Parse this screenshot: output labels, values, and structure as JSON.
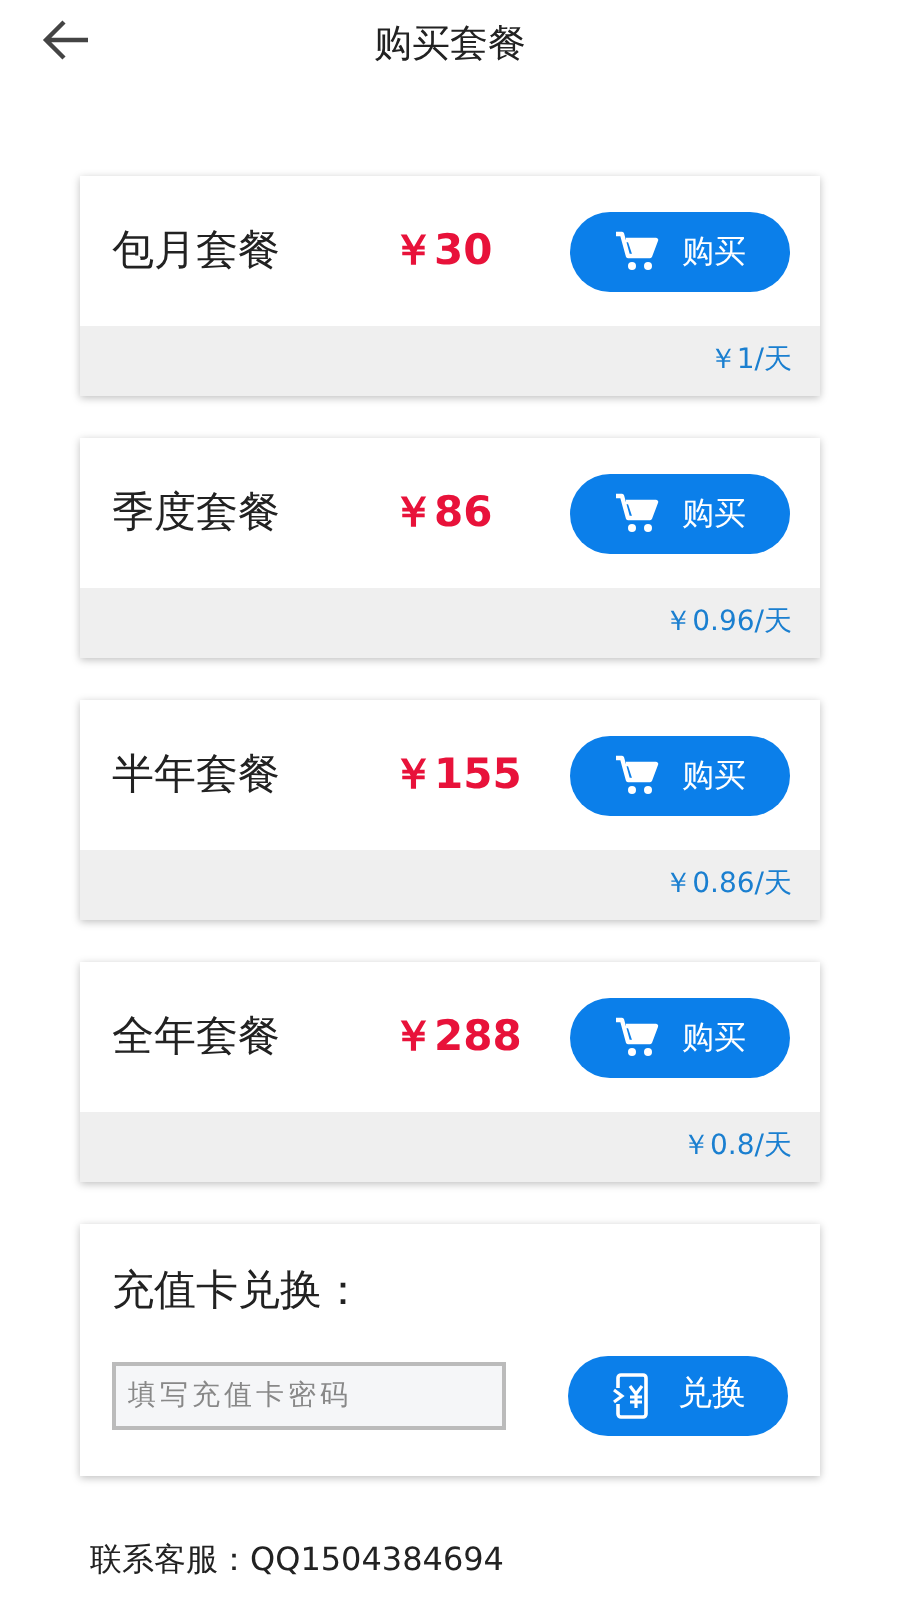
{
  "header": {
    "title": "购买套餐"
  },
  "plans": [
    {
      "name": "包月套餐",
      "price": "￥30",
      "button": "购买",
      "per_day": "￥1/天"
    },
    {
      "name": "季度套餐",
      "price": "￥86",
      "button": "购买",
      "per_day": "￥0.96/天"
    },
    {
      "name": "半年套餐",
      "price": "￥155",
      "button": "购买",
      "per_day": "￥0.86/天"
    },
    {
      "name": "全年套餐",
      "price": "￥288",
      "button": "购买",
      "per_day": "￥0.8/天"
    }
  ],
  "redeem": {
    "title": "充值卡兑换：",
    "placeholder": "填写充值卡密码",
    "button": "兑换"
  },
  "contact": "联系客服：QQ1504384694"
}
